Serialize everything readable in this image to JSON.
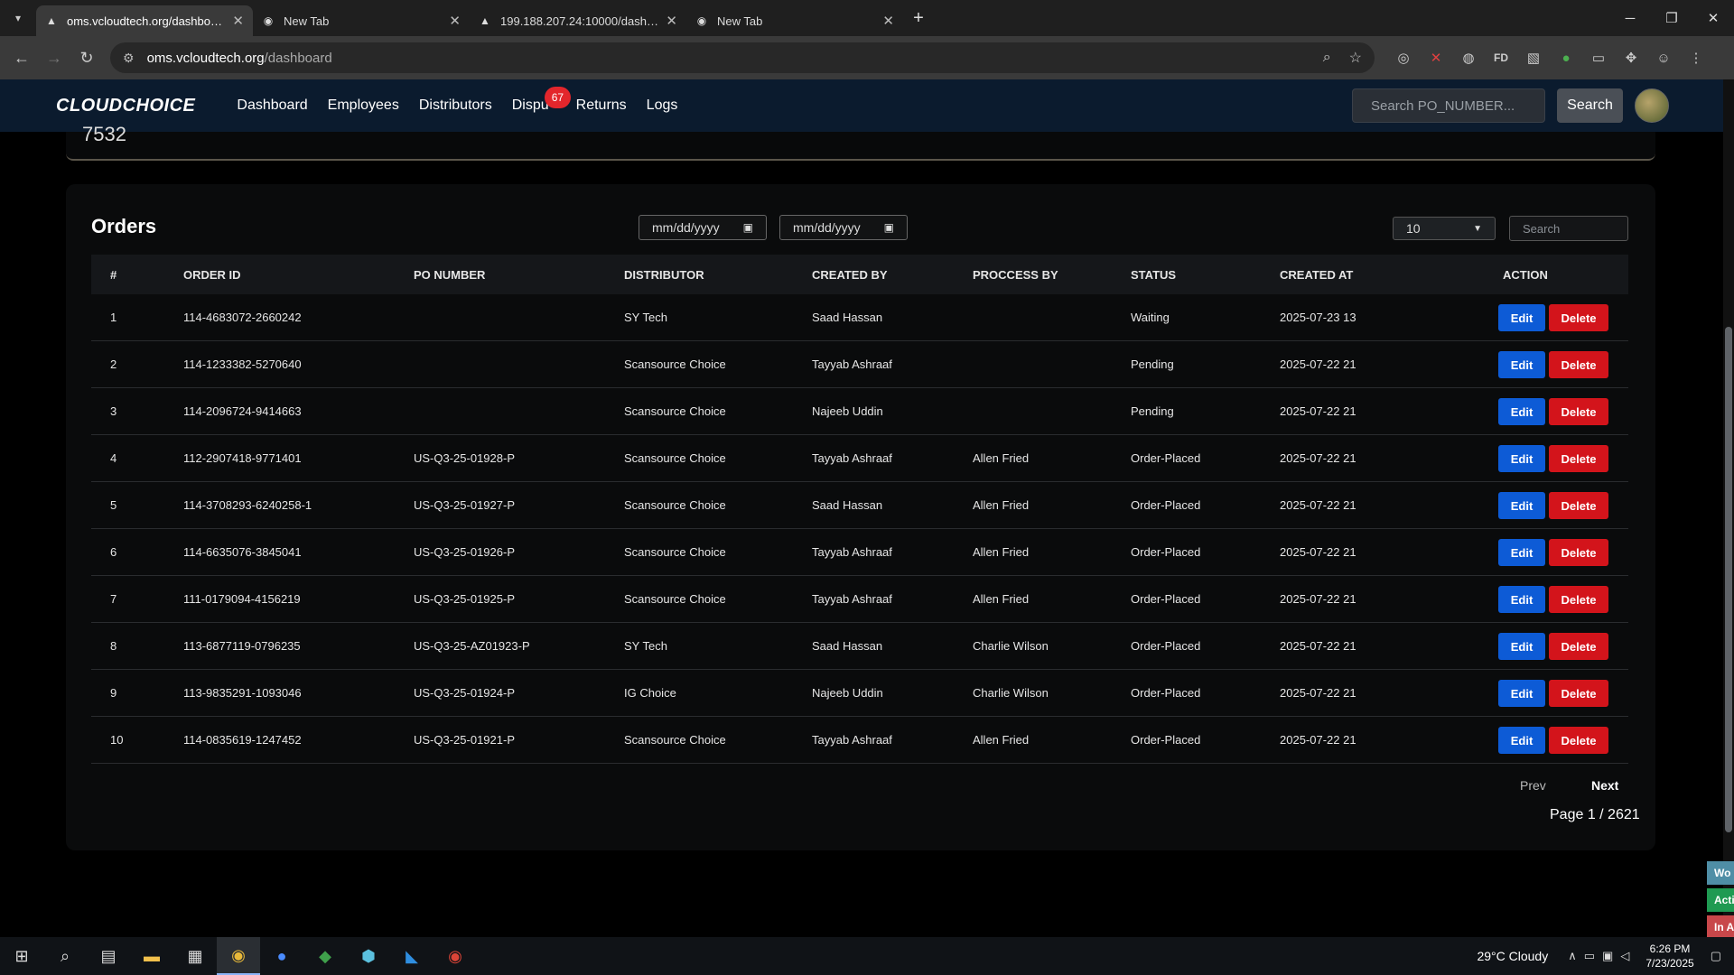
{
  "browser": {
    "tabs": [
      {
        "title": "oms.vcloudtech.org/dashboard",
        "active": true
      },
      {
        "title": "New Tab",
        "active": false
      },
      {
        "title": "199.188.207.24:10000/dashboard",
        "active": false
      },
      {
        "title": "New Tab",
        "active": false
      }
    ],
    "url_host": "oms.vcloudtech.org",
    "url_path": "/dashboard"
  },
  "app": {
    "logo": "CLOUDCHOICE",
    "nav": {
      "dashboard": "Dashboard",
      "employees": "Employees",
      "distributors": "Distributors",
      "disputes": "Dispu",
      "disputes_badge": "67",
      "returns": "Returns",
      "logs": "Logs"
    },
    "search_placeholder": "Search PO_NUMBER...",
    "search_button": "Search"
  },
  "top_card_text": "7532",
  "orders": {
    "title": "Orders",
    "date_from_placeholder": "mm/dd/yyyy",
    "date_to_placeholder": "mm/dd/yyyy",
    "per_page": "10",
    "search_placeholder": "Search",
    "columns": [
      "#",
      "ORDER ID",
      "PO NUMBER",
      "DISTRIBUTOR",
      "CREATED BY",
      "PROCCESS BY",
      "STATUS",
      "CREATED AT",
      "ACTION"
    ],
    "rows": [
      {
        "n": "1",
        "order_id": "114-4683072-2660242",
        "po": "",
        "distributor": "SY Tech",
        "created_by": "Saad Hassan",
        "process_by": "",
        "status": "Waiting",
        "created_at": "2025-07-23 13"
      },
      {
        "n": "2",
        "order_id": "114-1233382-5270640",
        "po": "",
        "distributor": "Scansource Choice",
        "created_by": "Tayyab Ashraaf",
        "process_by": "",
        "status": "Pending",
        "created_at": "2025-07-22 21"
      },
      {
        "n": "3",
        "order_id": "114-2096724-9414663",
        "po": "",
        "distributor": "Scansource Choice",
        "created_by": "Najeeb Uddin",
        "process_by": "",
        "status": "Pending",
        "created_at": "2025-07-22 21"
      },
      {
        "n": "4",
        "order_id": "112-2907418-9771401",
        "po": "US-Q3-25-01928-P",
        "distributor": "Scansource Choice",
        "created_by": "Tayyab Ashraaf",
        "process_by": "Allen Fried",
        "status": "Order-Placed",
        "created_at": "2025-07-22 21"
      },
      {
        "n": "5",
        "order_id": "114-3708293-6240258-1",
        "po": "US-Q3-25-01927-P",
        "distributor": "Scansource Choice",
        "created_by": "Saad Hassan",
        "process_by": "Allen Fried",
        "status": "Order-Placed",
        "created_at": "2025-07-22 21"
      },
      {
        "n": "6",
        "order_id": "114-6635076-3845041",
        "po": "US-Q3-25-01926-P",
        "distributor": "Scansource Choice",
        "created_by": "Tayyab Ashraaf",
        "process_by": "Allen Fried",
        "status": "Order-Placed",
        "created_at": "2025-07-22 21"
      },
      {
        "n": "7",
        "order_id": "111-0179094-4156219",
        "po": "US-Q3-25-01925-P",
        "distributor": "Scansource Choice",
        "created_by": "Tayyab Ashraaf",
        "process_by": "Allen Fried",
        "status": "Order-Placed",
        "created_at": "2025-07-22 21"
      },
      {
        "n": "8",
        "order_id": "113-6877119-0796235",
        "po": "US-Q3-25-AZ01923-P",
        "distributor": "SY Tech",
        "created_by": "Saad Hassan",
        "process_by": "Charlie Wilson",
        "status": "Order-Placed",
        "created_at": "2025-07-22 21"
      },
      {
        "n": "9",
        "order_id": "113-9835291-1093046",
        "po": "US-Q3-25-01924-P",
        "distributor": "IG Choice",
        "created_by": "Najeeb Uddin",
        "process_by": "Charlie Wilson",
        "status": "Order-Placed",
        "created_at": "2025-07-22 21"
      },
      {
        "n": "10",
        "order_id": "114-0835619-1247452",
        "po": "US-Q3-25-01921-P",
        "distributor": "Scansource Choice",
        "created_by": "Tayyab Ashraaf",
        "process_by": "Allen Fried",
        "status": "Order-Placed",
        "created_at": "2025-07-22 21"
      }
    ],
    "edit_label": "Edit",
    "delete_label": "Delete",
    "prev_label": "Prev",
    "next_label": "Next",
    "page_info": "Page 1 / 2621"
  },
  "side_tabs": [
    {
      "label": "Wo",
      "color": "#4f8ea6"
    },
    {
      "label": "Acti",
      "color": "#1f9a52"
    },
    {
      "label": "In A",
      "color": "#c8474a"
    }
  ],
  "taskbar": {
    "weather": "29°C  Cloudy",
    "time": "6:26 PM",
    "date": "7/23/2025"
  }
}
